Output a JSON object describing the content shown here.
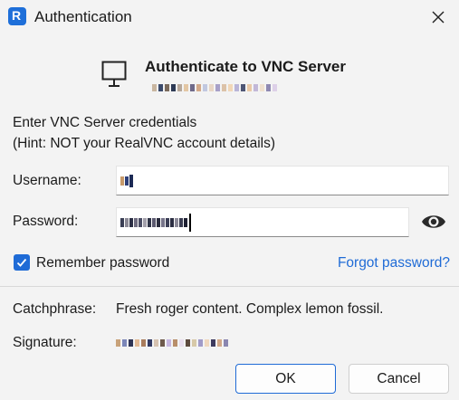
{
  "window": {
    "title": "Authentication",
    "app_icon_glyph": "R"
  },
  "header": {
    "title": "Authenticate to VNC Server",
    "icon": "monitor-icon"
  },
  "instructions": {
    "line1": "Enter VNC Server credentials",
    "line2": "(Hint: NOT your RealVNC account details)"
  },
  "form": {
    "username_label": "Username:",
    "password_label": "Password:",
    "remember_label": "Remember password",
    "remember_checked": true,
    "forgot_link": "Forgot password?",
    "show_password_icon": "eye-icon"
  },
  "info": {
    "catchphrase_label": "Catchphrase:",
    "catchphrase_value": "Fresh roger content. Complex lemon fossil.",
    "signature_label": "Signature:"
  },
  "buttons": {
    "ok": "OK",
    "cancel": "Cancel"
  },
  "colors": {
    "accent": "#1f6bd6",
    "background": "#f3f3f3"
  }
}
